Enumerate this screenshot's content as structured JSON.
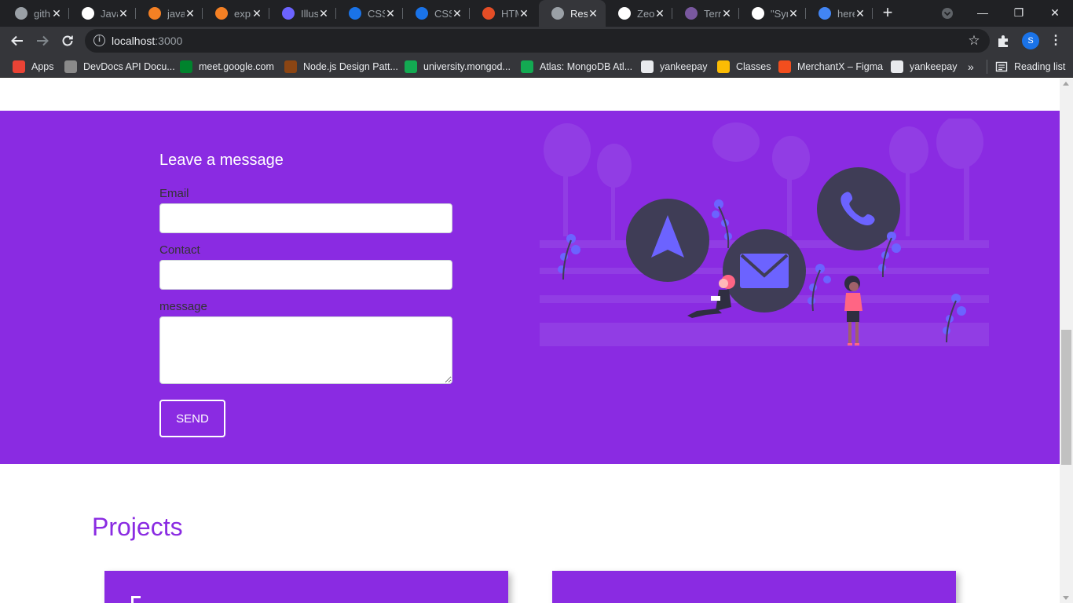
{
  "browser": {
    "tabs": [
      {
        "title": "gith",
        "icon": "globe-icon",
        "color": "#9aa0a6"
      },
      {
        "title": "Java",
        "icon": "github-icon",
        "color": "#ffffff"
      },
      {
        "title": "java",
        "icon": "stackoverflow-icon",
        "color": "#f48024"
      },
      {
        "title": "expr",
        "icon": "stackoverflow-icon",
        "color": "#f48024"
      },
      {
        "title": "Illus",
        "icon": "undraw-icon",
        "color": "#6c63ff"
      },
      {
        "title": "CSS",
        "icon": "css-icon",
        "color": "#1a73e8"
      },
      {
        "title": "CSS",
        "icon": "css-icon",
        "color": "#1a73e8"
      },
      {
        "title": "HTM",
        "icon": "html-icon",
        "color": "#e44d26"
      },
      {
        "title": "Resu",
        "icon": "globe-icon",
        "color": "#9aa0a6",
        "active": true
      },
      {
        "title": "Zeo",
        "icon": "github-icon",
        "color": "#ffffff"
      },
      {
        "title": "Terr",
        "icon": "heroku-icon",
        "color": "#79589f"
      },
      {
        "title": "\"Syr",
        "icon": "github-icon",
        "color": "#ffffff"
      },
      {
        "title": "here",
        "icon": "google-icon",
        "color": "#4285f4"
      }
    ],
    "url_host": "localhost",
    "url_port": ":3000",
    "profile_initial": "S",
    "bookmarks": [
      {
        "label": "Apps",
        "color": "#ea4335"
      },
      {
        "label": "DevDocs API Docu...",
        "color": "#8a8a8a"
      },
      {
        "label": "meet.google.com",
        "color": "#00832d"
      },
      {
        "label": "Node.js Design Patt...",
        "color": "#8b4513"
      },
      {
        "label": "university.mongod...",
        "color": "#13aa52"
      },
      {
        "label": "Atlas: MongoDB Atl...",
        "color": "#13aa52"
      },
      {
        "label": "yankeepay",
        "color": "#e8eaed"
      },
      {
        "label": "Classes",
        "color": "#fbbc04"
      },
      {
        "label": "MerchantX – Figma",
        "color": "#f24e1e"
      },
      {
        "label": "yankeepay",
        "color": "#e8eaed"
      }
    ],
    "more_bookmarks": "»",
    "reading_list": "Reading list"
  },
  "page": {
    "form": {
      "title": "Leave a message",
      "email_label": "Email",
      "contact_label": "Contact",
      "message_label": "message",
      "email_value": "",
      "contact_value": "",
      "message_value": "",
      "send_label": "SEND"
    },
    "projects_title": "Projects",
    "colors": {
      "accent": "#8a2be2",
      "illustration": "#6c63ff"
    }
  }
}
